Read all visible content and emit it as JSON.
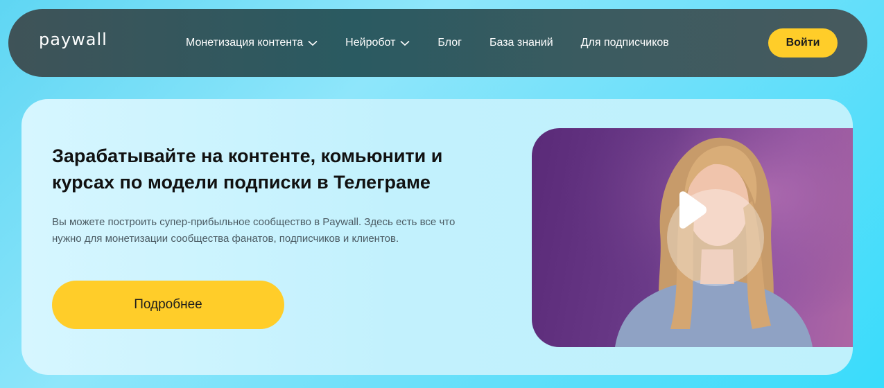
{
  "header": {
    "logo": "paywall",
    "menu": [
      {
        "label": "Монетизация контента",
        "dropdown": true
      },
      {
        "label": "Нейробот",
        "dropdown": true
      },
      {
        "label": "Блог",
        "dropdown": false
      },
      {
        "label": "База знаний",
        "dropdown": false
      },
      {
        "label": "Для подписчиков",
        "dropdown": false
      }
    ],
    "login_label": "Войти"
  },
  "hero": {
    "title": "Зарабатывайте на контенте, комьюнити и курсах по модели подписки в Телеграме",
    "description": "Вы можете построить супер-прибыльное сообщество в Paywall. Здесь есть все что нужно для монетизации сообщества фанатов, подписчиков и клиентов.",
    "cta_label": "Подробнее"
  },
  "video": {
    "icon": "play-icon"
  },
  "colors": {
    "accent": "#ffcd29",
    "nav_bg": "#2f5a60",
    "hero_bg": "#c6f2fd"
  }
}
